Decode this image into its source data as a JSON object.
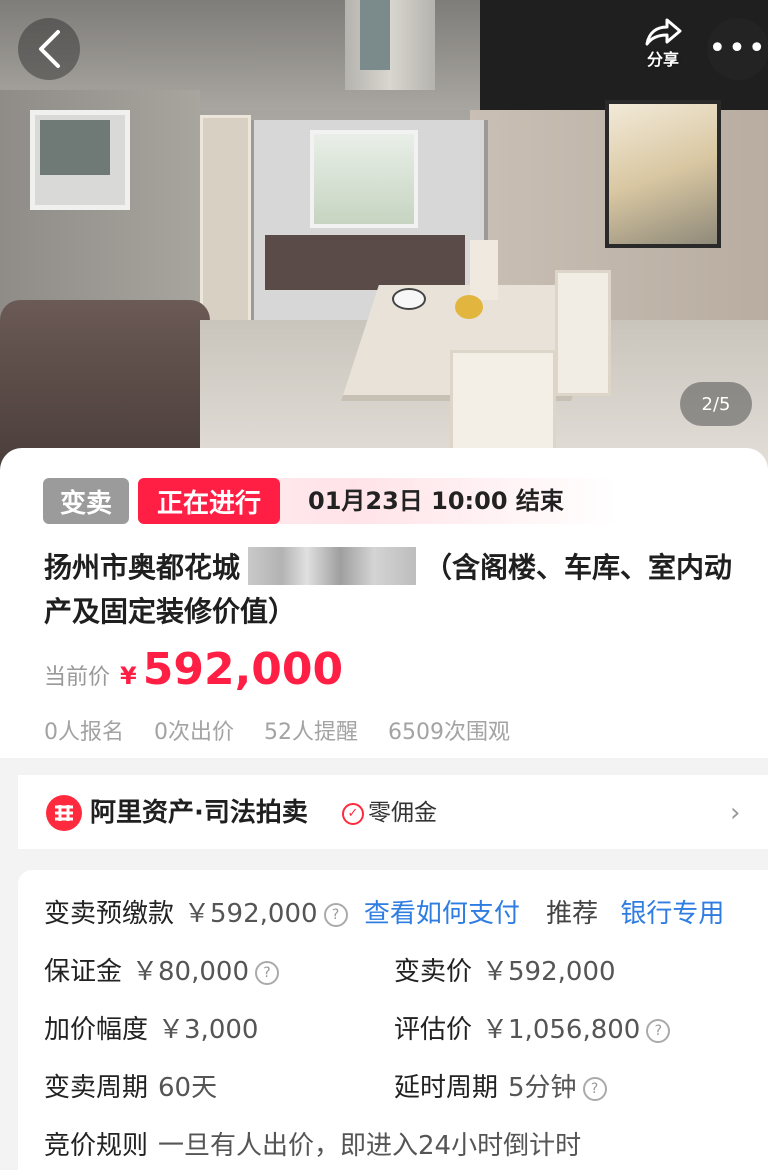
{
  "header": {
    "share_label": "分享",
    "more_label": "•••",
    "image_indicator": "2/5"
  },
  "auction": {
    "type_tag": "变卖",
    "status_tag": "正在进行",
    "end_time": "01月23日 10:00 结束",
    "title_part1": "扬州市奥都花城",
    "title_part2": "（含阁楼、车库、室内动产及固定装修价值）",
    "price_label": "当前价",
    "currency": "¥",
    "current_price": "592,000",
    "stats": [
      "0人报名",
      "0次出价",
      "52人提醒",
      "6509次围观"
    ]
  },
  "platform": {
    "name": "阿里资产·司法拍卖",
    "badge": "零佣金"
  },
  "details": {
    "prepay_label": "变卖预缴款",
    "prepay_value": "￥592,000",
    "pay_link": "查看如何支付",
    "recommend_label": "推荐",
    "recommend_link": "银行专用",
    "deposit_label": "保证金",
    "deposit_value": "￥80,000",
    "sale_price_label": "变卖价",
    "sale_price_value": "￥592,000",
    "increment_label": "加价幅度",
    "increment_value": "￥3,000",
    "appraisal_label": "评估价",
    "appraisal_value": "￥1,056,800",
    "period_label": "变卖周期",
    "period_value": "60天",
    "delay_label": "延时周期",
    "delay_value": "5分钟",
    "rule_label": "竞价规则",
    "rule_value": "一旦有人出价，即进入24小时倒计时"
  },
  "colors": {
    "accent": "#ff1f45",
    "link": "#2f7de1"
  }
}
